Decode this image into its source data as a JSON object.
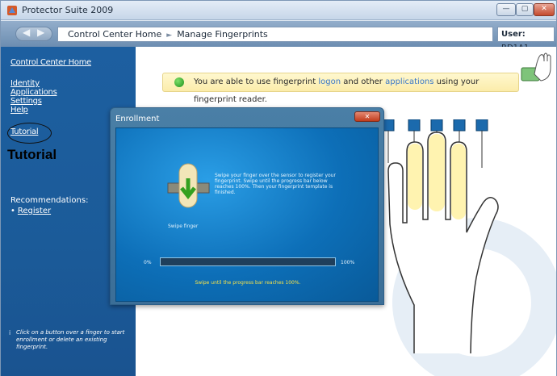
{
  "window": {
    "title": "Protector Suite 2009",
    "min": "—",
    "max": "▢",
    "close": "✕"
  },
  "nav": {
    "back": "◀",
    "forward": "▶",
    "crumb_1": "Control Center Home",
    "crumb_sep": "►",
    "crumb_2": "Manage Fingerprints",
    "user_label": "User:",
    "user_value": "RD1A1"
  },
  "sidebar": {
    "home": "Control Center Home",
    "identity": "Identity",
    "applications": "Applications",
    "settings": "Settings",
    "help": "Help",
    "tutorial": "Tutorial",
    "recommendations": "Recommendations:",
    "register": "Register",
    "hint_icon": "i",
    "hint": "Click on a button over a finger to start enrollment or delete an existing fingerprint."
  },
  "annotation": {
    "label": "Tutorial"
  },
  "banner": {
    "text_1": "You are able to use fingerprint",
    "link_1": "logon",
    "text_2": "and other",
    "link_2": "applications",
    "text_3": "using your fingerprint reader."
  },
  "enrollment": {
    "title": "Enrollment",
    "close": "✕",
    "swipe_label": "Swipe finger",
    "instructions": "Swipe your finger over the sensor to register your fingerprint. Swipe until the progress bar below reaches 100%. Then your fingerprint template is finished.",
    "pct_start": "0%",
    "pct_end": "100%",
    "progress": 0,
    "message": "Swipe until the progress bar reaches 100%."
  },
  "icons": {
    "app": "fingerprint-app-icon",
    "reader": "fingerprint-reader-icon",
    "hand": "hand-icon",
    "finger_button": "finger-enroll-button"
  },
  "colors": {
    "sidebar": "#1b5b99",
    "banner": "#fbecaa",
    "dialog": "#0d6fb8",
    "progress_msg": "#f5e24a"
  }
}
